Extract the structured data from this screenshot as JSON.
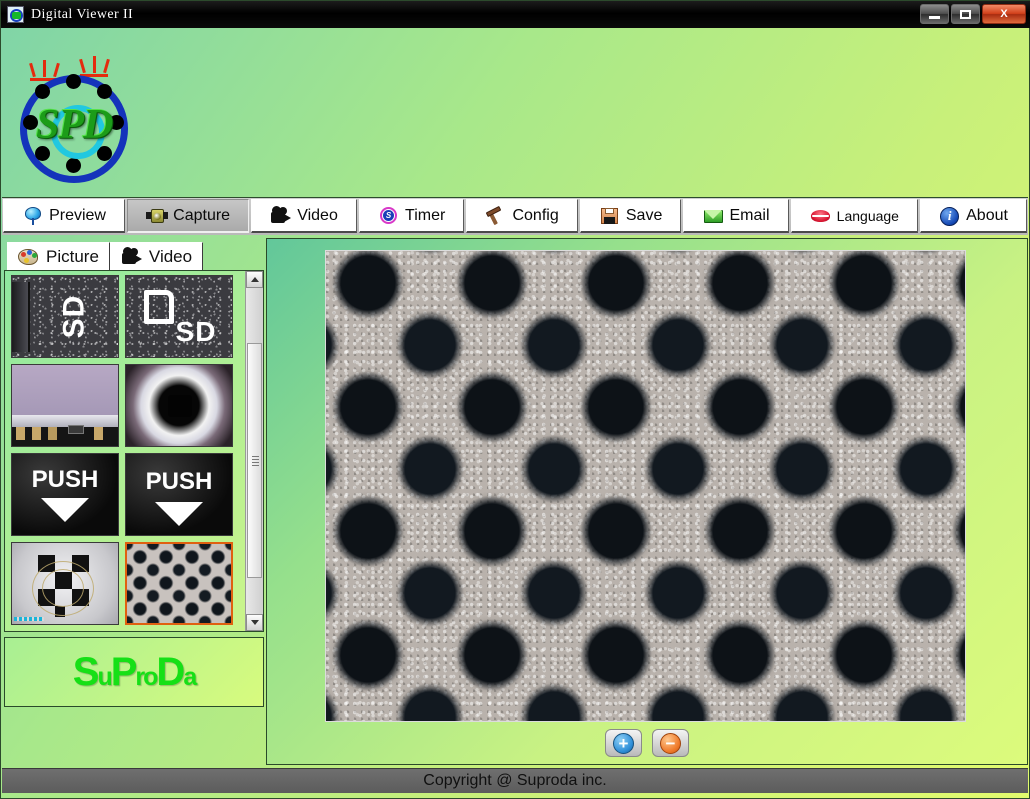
{
  "window": {
    "title": "Digital Viewer II",
    "icon": "app-logo-icon",
    "controls": {
      "minimize": "minimize-button",
      "maximize": "maximize-button",
      "close_label": "X"
    }
  },
  "header": {
    "logo_text": "SPD",
    "logo_icon": "spd-circular-logo"
  },
  "toolbar": {
    "items": [
      {
        "label": "Preview",
        "icon": "preview-icon",
        "state": "normal"
      },
      {
        "label": "Capture",
        "icon": "camera-icon",
        "state": "pressed"
      },
      {
        "label": "Video",
        "icon": "movie-camera-icon",
        "state": "normal"
      },
      {
        "label": "Timer",
        "icon": "clock-icon",
        "state": "normal",
        "badge": "S"
      },
      {
        "label": "Config",
        "icon": "hammer-icon",
        "state": "normal"
      },
      {
        "label": "Save",
        "icon": "floppy-disk-icon",
        "state": "normal"
      },
      {
        "label": "Email",
        "icon": "envelope-icon",
        "state": "normal"
      },
      {
        "label": "Language",
        "icon": "lips-icon",
        "state": "normal"
      },
      {
        "label": "About",
        "icon": "info-icon",
        "state": "normal",
        "badge": "i"
      }
    ]
  },
  "sidebar": {
    "tabs": [
      {
        "label": "Picture",
        "icon": "palette-icon",
        "active": true
      },
      {
        "label": "Video",
        "icon": "movie-camera-icon",
        "active": false
      }
    ],
    "thumbnails": [
      {
        "name": "thumb-sd-text-rotated",
        "caption": "SD",
        "style": "speckle-rotated",
        "selected": false
      },
      {
        "name": "thumb-sd-card-logo",
        "caption": "SD",
        "style": "sd-logo",
        "selected": false
      },
      {
        "name": "thumb-circuit-board",
        "caption": "",
        "style": "circuit",
        "selected": false
      },
      {
        "name": "thumb-lens-aperture",
        "caption": "",
        "style": "lens",
        "selected": false
      },
      {
        "name": "thumb-push-label-1",
        "caption": "PUSH",
        "style": "push",
        "selected": false
      },
      {
        "name": "thumb-push-label-2",
        "caption": "PUSH",
        "style": "push",
        "selected": false
      },
      {
        "name": "thumb-resolution-chart",
        "caption": "",
        "style": "checker",
        "selected": false
      },
      {
        "name": "thumb-perforated-metal",
        "caption": "",
        "style": "perforated",
        "selected": true
      }
    ],
    "brand": {
      "part1": "S",
      "part2": "u",
      "part3": "P",
      "part4": "ro",
      "part5": "D",
      "part6": "a"
    }
  },
  "viewer": {
    "image_name": "perforated-metal-macro",
    "zoom_in_label": "+",
    "zoom_out_label": "−"
  },
  "statusbar": {
    "text": "Copyright @ Suproda inc."
  },
  "colors": {
    "accent_green": "#16e016",
    "selection_orange": "#e06010",
    "logo_blue": "#1433bb",
    "logo_cyan": "#21c8e0"
  }
}
